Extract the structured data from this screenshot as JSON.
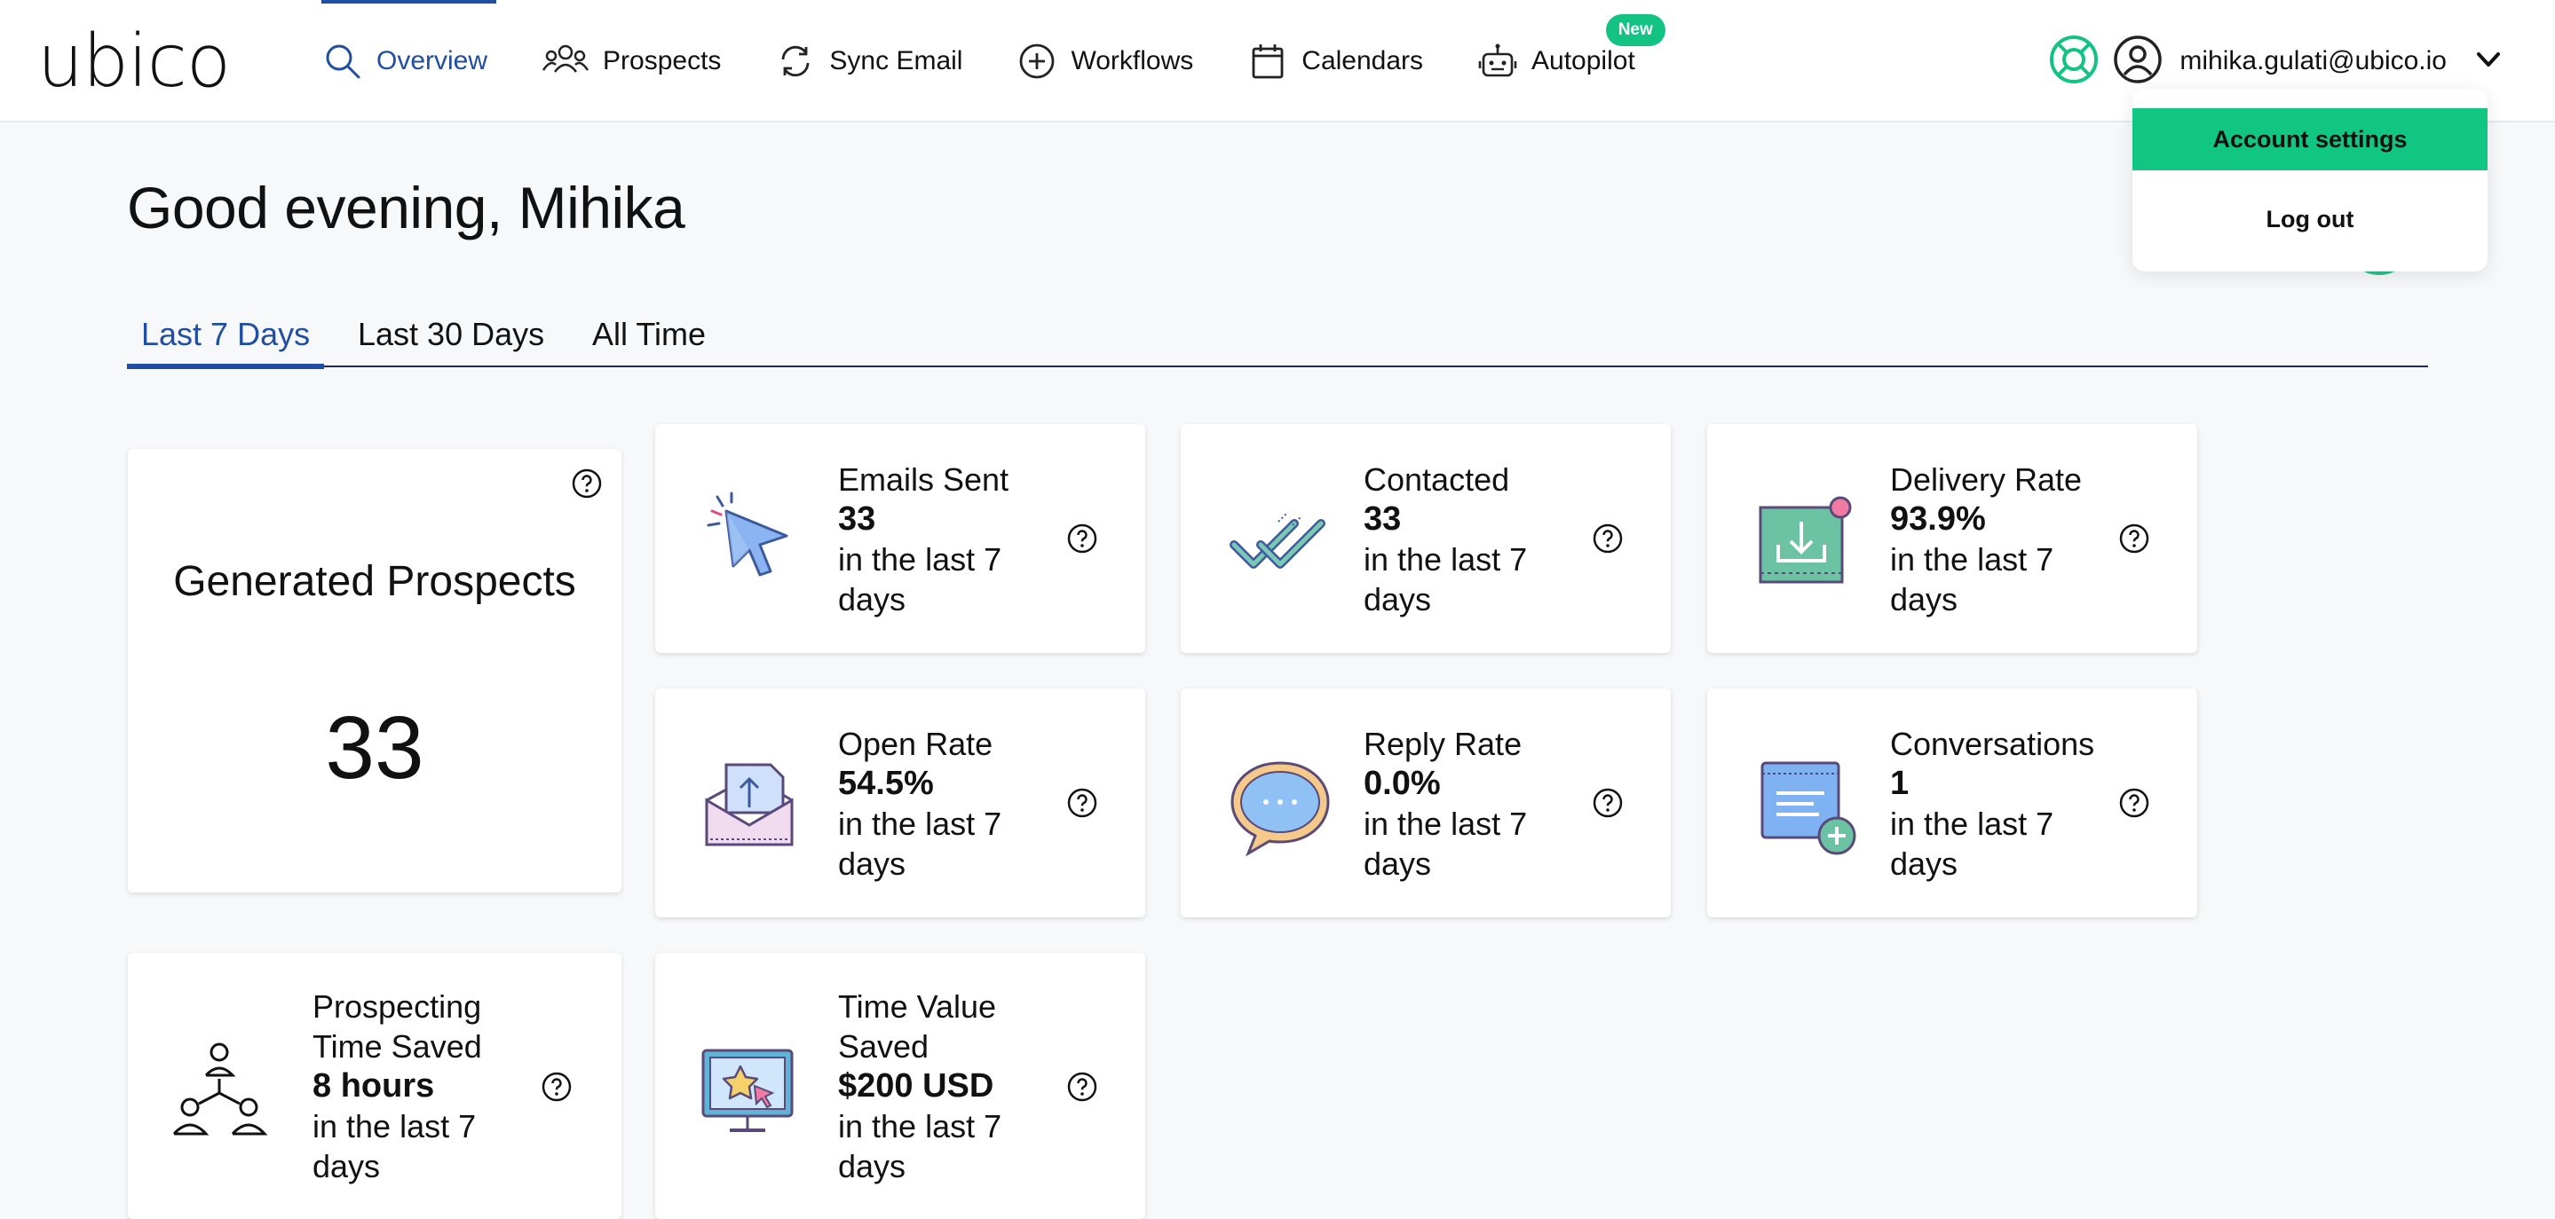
{
  "brand": {
    "logo": "ubico"
  },
  "nav": {
    "items": [
      {
        "label": "Overview",
        "icon": "search-icon"
      },
      {
        "label": "Prospects",
        "icon": "people-icon"
      },
      {
        "label": "Sync Email",
        "icon": "sync-icon"
      },
      {
        "label": "Workflows",
        "icon": "plus-circle-icon"
      },
      {
        "label": "Calendars",
        "icon": "calendar-icon"
      },
      {
        "label": "Autopilot",
        "icon": "robot-icon",
        "badge": "New"
      }
    ]
  },
  "user": {
    "email": "mihika.gulati@ubico.io"
  },
  "menu": {
    "account_settings": "Account settings",
    "log_out": "Log out"
  },
  "greeting": "Good evening, Mihika",
  "tabs": [
    "Last 7 Days",
    "Last 30 Days",
    "All Time"
  ],
  "generated": {
    "title": "Generated Prospects",
    "value": "33"
  },
  "stats": [
    {
      "title": "Emails Sent",
      "value": "33",
      "period1": "in the last 7",
      "period2": "days",
      "icon": "cursor-click-icon"
    },
    {
      "title": "Contacted",
      "value": "33",
      "period1": "in the last 7",
      "period2": "days",
      "icon": "double-check-icon"
    },
    {
      "title": "Delivery Rate",
      "value": "93.9%",
      "period1": "in the last 7",
      "period2": "days",
      "icon": "download-inbox-icon"
    },
    {
      "title": "Open Rate",
      "value": "54.5%",
      "period1": "in the last 7",
      "period2": "days",
      "icon": "open-envelope-icon"
    },
    {
      "title": "Reply Rate",
      "value": "0.0%",
      "period1": "in the last 7",
      "period2": "days",
      "icon": "speech-bubble-icon"
    },
    {
      "title": "Conversations",
      "value": "1",
      "period1": "in the last 7",
      "period2": "days",
      "icon": "add-note-icon"
    }
  ],
  "bottom": [
    {
      "title1": "Prospecting",
      "title2": "Time Saved",
      "value": "8 hours",
      "period1": "in the last 7",
      "period2": "days",
      "icon": "people-network-icon"
    },
    {
      "title1": "Time Value",
      "title2": "Saved",
      "value": "$200 USD",
      "period1": "in the last 7",
      "period2": "days",
      "icon": "monitor-star-icon"
    }
  ],
  "colors": {
    "accent": "#1f4ea3",
    "green": "#10c682"
  }
}
